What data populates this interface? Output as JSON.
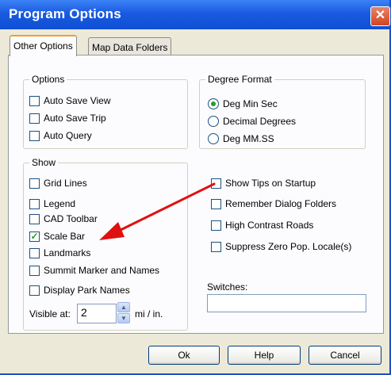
{
  "window": {
    "title": "Program Options",
    "close_label": "✕"
  },
  "tabs": [
    {
      "label": "Other Options",
      "active": true
    },
    {
      "label": "Map Data Folders",
      "active": false
    }
  ],
  "options_group": {
    "label": "Options",
    "items": [
      {
        "label": "Auto Save View",
        "checked": false
      },
      {
        "label": "Auto Save Trip",
        "checked": false
      },
      {
        "label": "Auto Query",
        "checked": false
      }
    ]
  },
  "degree_group": {
    "label": "Degree Format",
    "items": [
      {
        "label": "Deg Min Sec",
        "selected": true
      },
      {
        "label": "Decimal Degrees",
        "selected": false
      },
      {
        "label": "Deg MM.SS",
        "selected": false
      }
    ]
  },
  "show_group": {
    "label": "Show",
    "items": [
      {
        "label": "Grid Lines",
        "checked": false
      },
      {
        "label": "Legend",
        "checked": false
      },
      {
        "label": "CAD Toolbar",
        "checked": false
      },
      {
        "label": "Scale Bar",
        "checked": true
      },
      {
        "label": "Landmarks",
        "checked": false
      },
      {
        "label": "Summit Marker and Names",
        "checked": false
      },
      {
        "label": "Display Park Names",
        "checked": false
      }
    ],
    "visible_at_label": "Visible at:",
    "visible_at_value": "2",
    "visible_at_unit": "mi / in."
  },
  "right_options": [
    {
      "label": "Show Tips on Startup",
      "checked": false
    },
    {
      "label": "Remember Dialog Folders",
      "checked": false
    },
    {
      "label": "High Contrast Roads",
      "checked": false
    },
    {
      "label": "Suppress Zero Pop. Locale(s)",
      "checked": false
    }
  ],
  "switches": {
    "label": "Switches:",
    "value": ""
  },
  "buttons": {
    "ok": "Ok",
    "help": "Help",
    "cancel": "Cancel"
  },
  "colors": {
    "titlebar": "#1a5ae0",
    "check": "#21a121",
    "annotation_arrow": "#e01010"
  }
}
